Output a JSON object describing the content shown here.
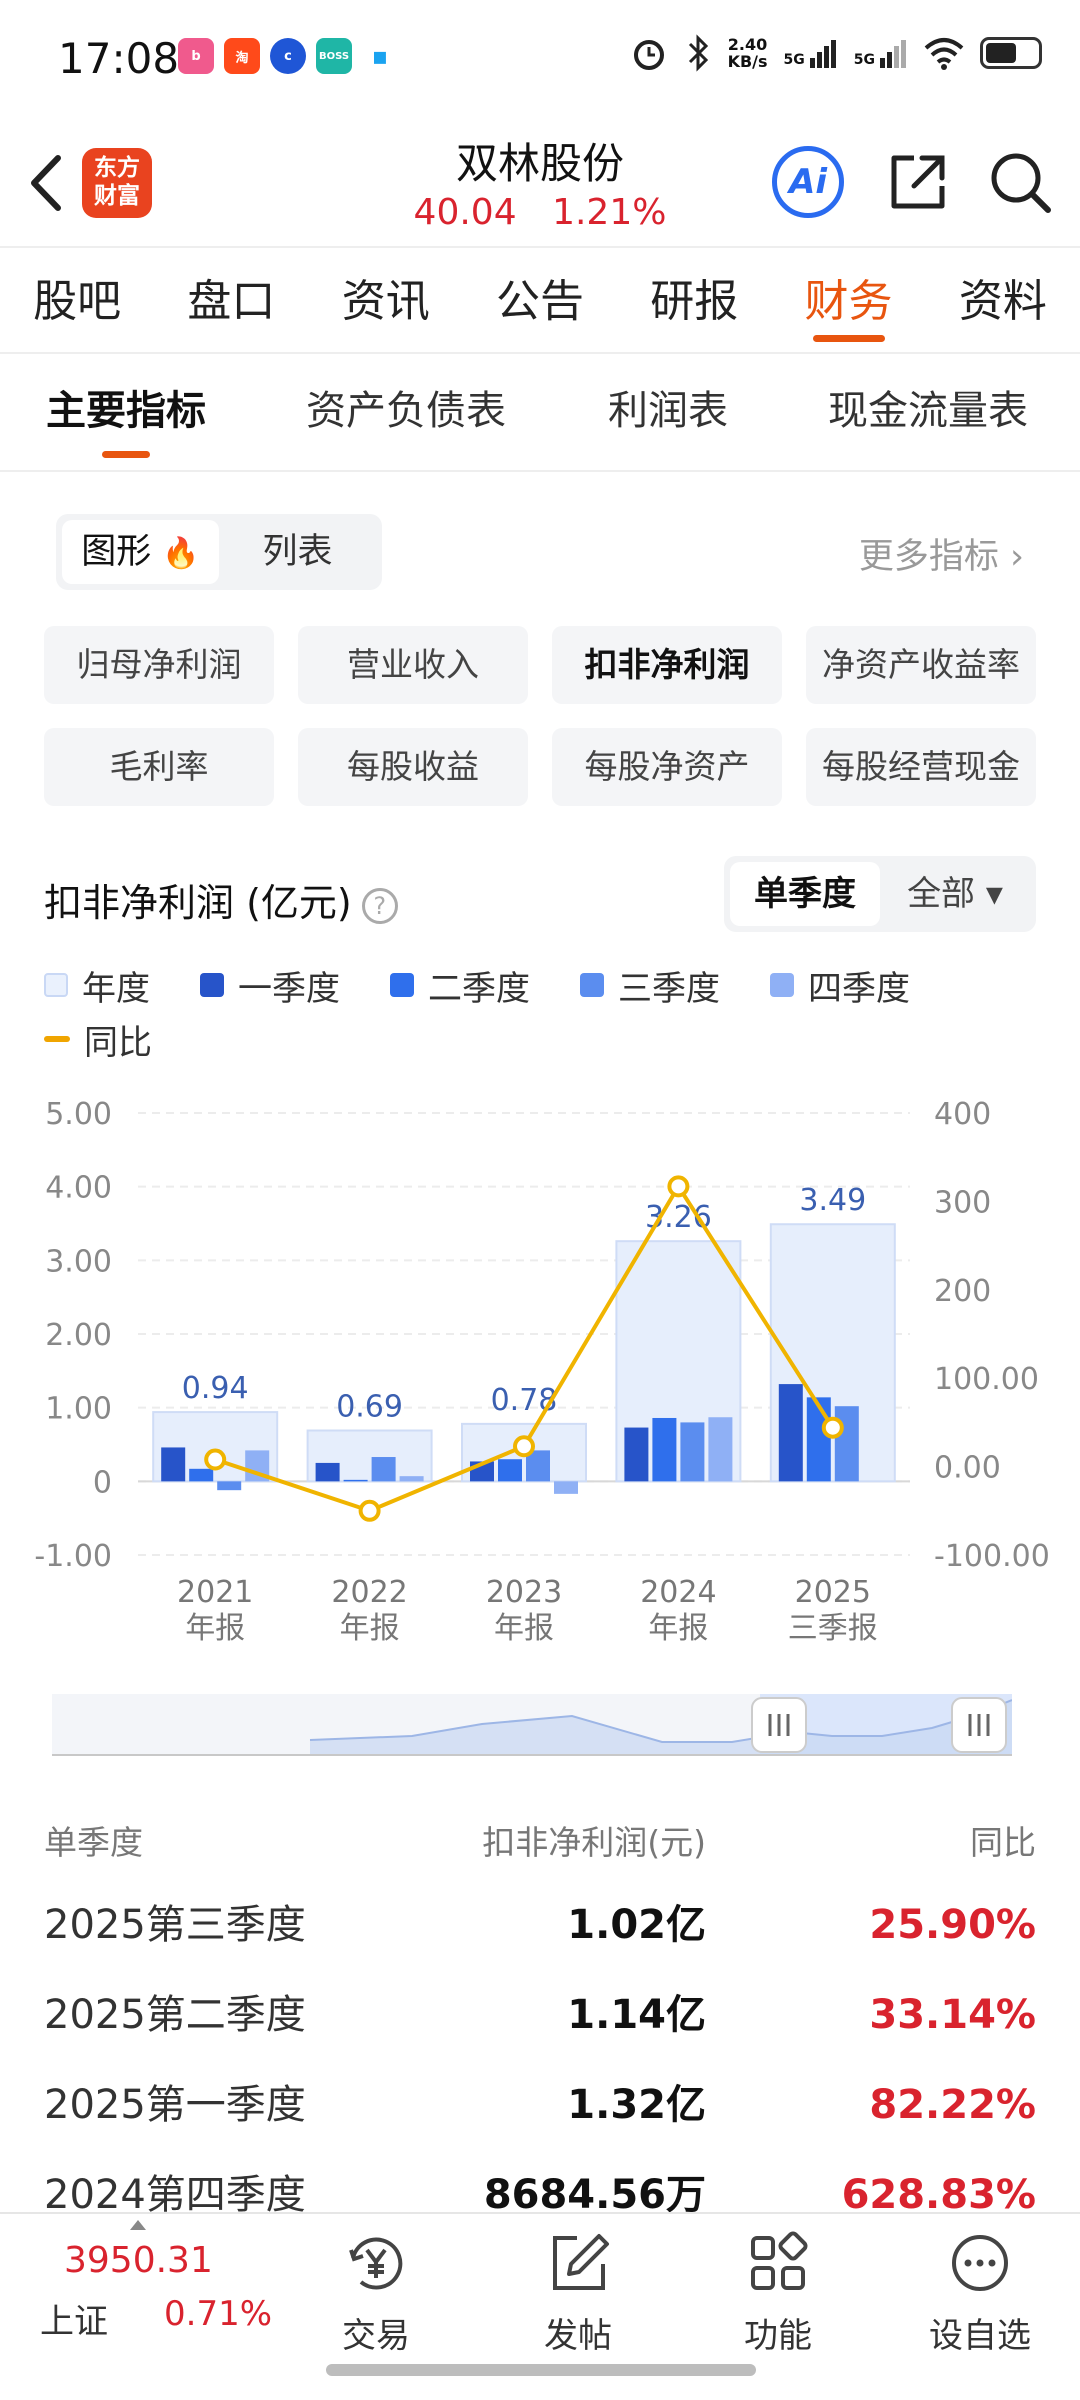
{
  "status": {
    "time": "17:08",
    "speed_top": "2.40",
    "speed_unit": "KB/s",
    "net1": "5G",
    "net2": "5G"
  },
  "header": {
    "logo_line1": "东方",
    "logo_line2": "财富",
    "stock_name": "双林股份",
    "price": "40.04",
    "change_pct": "1.21%",
    "ai_label": "Ai"
  },
  "top_tabs": [
    "股吧",
    "盘口",
    "资讯",
    "公告",
    "研报",
    "财务",
    "资料"
  ],
  "sub_tabs": [
    "主要指标",
    "资产负债表",
    "利润表",
    "现金流量表"
  ],
  "view_toggle": {
    "graph": "图形",
    "list": "列表"
  },
  "more_link": "更多指标 ›",
  "metrics": [
    "归母净利润",
    "营业收入",
    "扣非净利润",
    "净资产收益率",
    "毛利率",
    "每股收益",
    "每股净资产",
    "每股经营现金"
  ],
  "chart_title": "扣非净利润 (亿元)",
  "period_toggle": {
    "single": "单季度",
    "all": "全部 ▾"
  },
  "legend": {
    "annual": "年度",
    "q1": "一季度",
    "q2": "二季度",
    "q3": "三季度",
    "q4": "四季度",
    "yoy": "同比"
  },
  "colors": {
    "annual_fill": "#e6eefc",
    "q1": "#2754c9",
    "q2": "#2f6fec",
    "q3": "#5b8def",
    "q4": "#8fb0f5",
    "yoy": "#f0b400",
    "red": "#d9232e",
    "accent": "#e8550f"
  },
  "chart_data": {
    "type": "bar",
    "categories": [
      [
        "2021",
        "年报"
      ],
      [
        "2022",
        "年报"
      ],
      [
        "2023",
        "年报"
      ],
      [
        "2024",
        "年报"
      ],
      [
        "2025",
        "三季报"
      ]
    ],
    "annual_values": [
      0.94,
      0.69,
      0.78,
      3.26,
      3.49
    ],
    "series": [
      {
        "name": "一季度",
        "values": [
          0.46,
          0.25,
          0.27,
          0.73,
          1.32
        ]
      },
      {
        "name": "二季度",
        "values": [
          0.17,
          0.02,
          0.3,
          0.86,
          1.14
        ]
      },
      {
        "name": "三季度",
        "values": [
          -0.12,
          0.33,
          0.42,
          0.8,
          1.02
        ]
      },
      {
        "name": "四季度",
        "values": [
          0.42,
          0.07,
          -0.17,
          0.87,
          null
        ]
      }
    ],
    "yoy": {
      "name": "同比",
      "values": [
        8,
        -50,
        23,
        317,
        44
      ]
    },
    "ylim": [
      -1,
      5
    ],
    "yticks": [
      "5.00",
      "4.00",
      "3.00",
      "2.00",
      "1.00",
      "0",
      "-1.00"
    ],
    "y2lim": [
      -100,
      400
    ],
    "y2ticks": [
      "400",
      "300",
      "200",
      "100.00",
      "0.00",
      "-100.00"
    ],
    "annual_labels": [
      "0.94",
      "0.69",
      "0.78",
      "3.26",
      "3.49"
    ]
  },
  "table": {
    "headers": [
      "单季度",
      "扣非净利润(元)",
      "同比"
    ],
    "rows": [
      [
        "2025第三季度",
        "1.02亿",
        "25.90%"
      ],
      [
        "2025第二季度",
        "1.14亿",
        "33.14%"
      ],
      [
        "2025第一季度",
        "1.32亿",
        "82.22%"
      ],
      [
        "2024第四季度",
        "8684.56万",
        "628.83%"
      ]
    ]
  },
  "bottom": {
    "index_value": "3950.31",
    "index_name": "上证",
    "index_pct": "0.71%",
    "items": [
      "交易",
      "发帖",
      "功能",
      "设自选"
    ]
  }
}
